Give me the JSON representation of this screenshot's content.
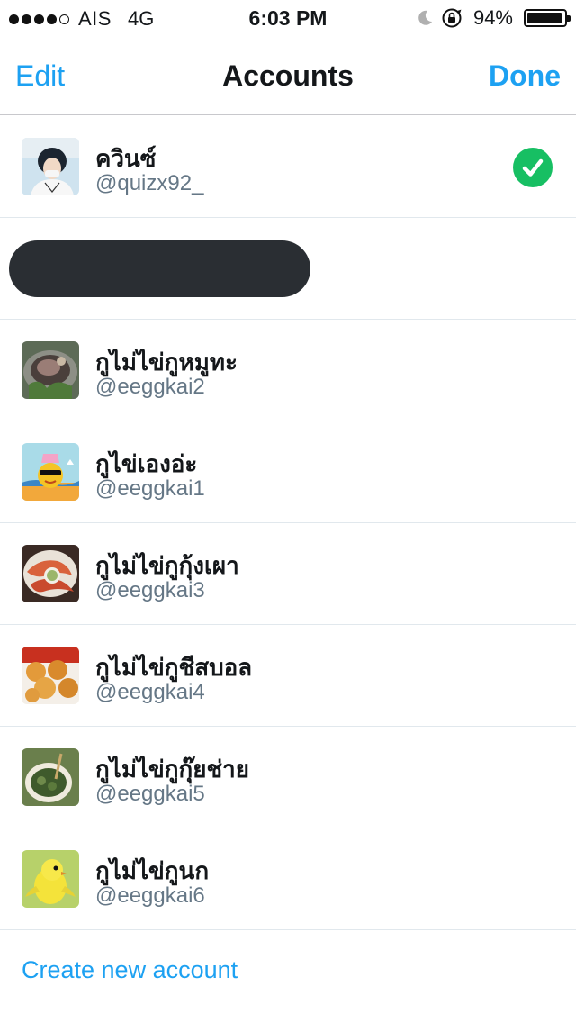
{
  "status_bar": {
    "carrier": "AIS",
    "network": "4G",
    "time": "6:03 PM",
    "battery_percent": "94%",
    "battery_level": 0.94
  },
  "nav": {
    "edit_label": "Edit",
    "title": "Accounts",
    "done_label": "Done"
  },
  "accounts": [
    {
      "name": "ควินซ์",
      "handle": "@quizx92_",
      "selected": true,
      "avatar_icon": "person-photo"
    },
    {
      "redacted": true
    },
    {
      "name": "กูไม่ไข่กูหมูทะ",
      "handle": "@eeggkai2",
      "avatar_icon": "bbq-photo"
    },
    {
      "name": "กูไข่เองอ่ะ",
      "handle": "@eeggkai1",
      "avatar_icon": "egg-cartoon"
    },
    {
      "name": "กูไม่ไข่กูกุ้งเผา",
      "handle": "@eeggkai3",
      "avatar_icon": "grilled-shrimp-photo"
    },
    {
      "name": "กูไม่ไข่กูชีสบอล",
      "handle": "@eeggkai4",
      "avatar_icon": "cheese-ball-photo"
    },
    {
      "name": "กูไม่ไข่กูกุ๊ยช่าย",
      "handle": "@eeggkai5",
      "avatar_icon": "kuichai-photo"
    },
    {
      "name": "กูไม่ไข่กูนก",
      "handle": "@eeggkai6",
      "avatar_icon": "bird-photo"
    }
  ],
  "create_label": "Create new account",
  "colors": {
    "accent": "#1da1f2",
    "check": "#17bf63",
    "handle": "#657786"
  }
}
